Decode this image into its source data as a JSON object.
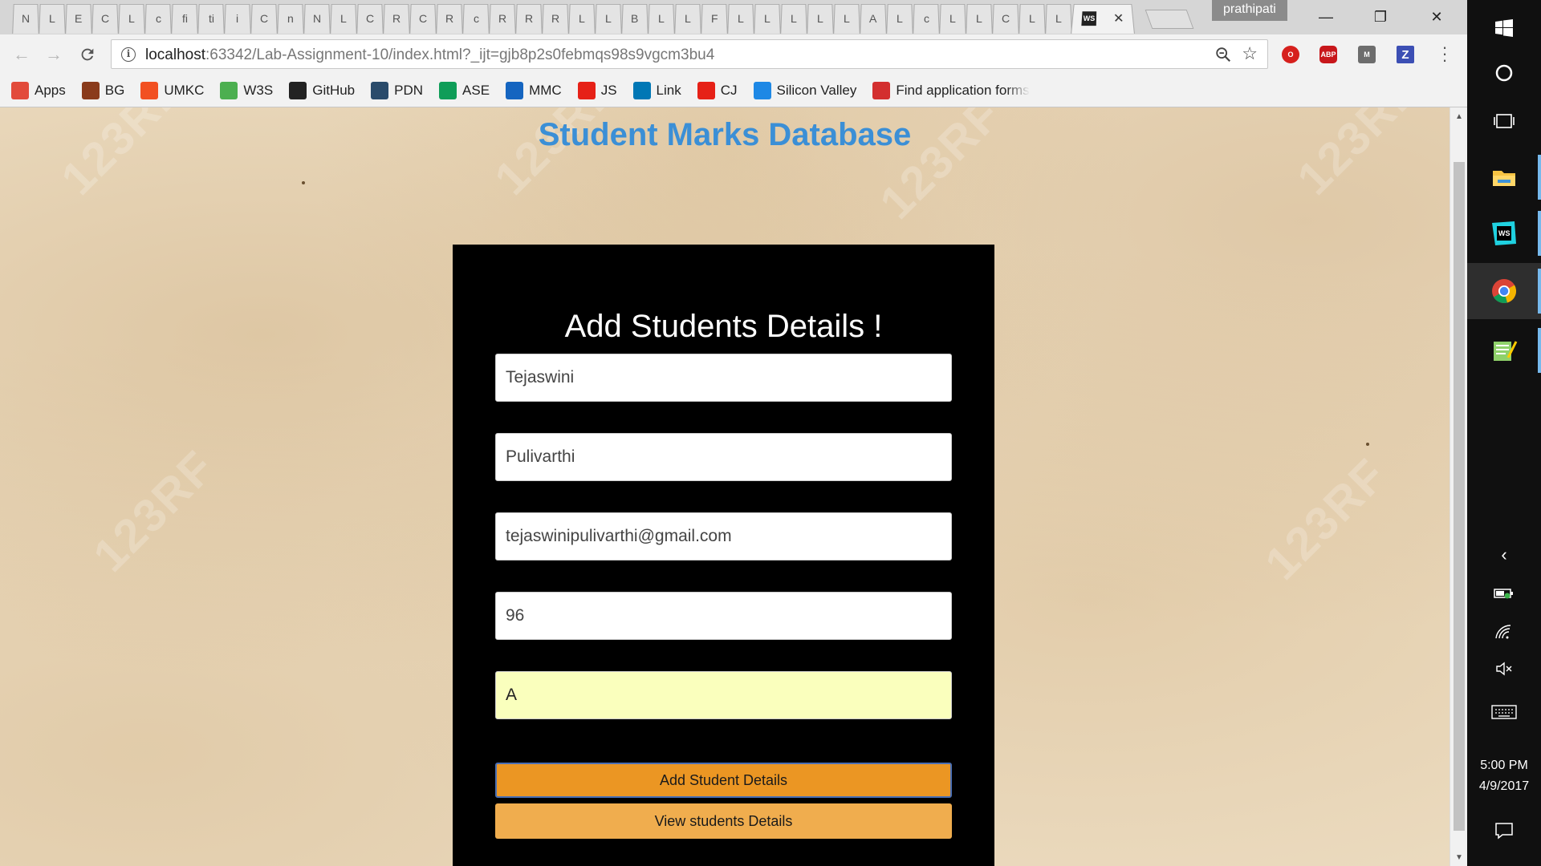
{
  "browser": {
    "tabs": [
      "N",
      "L",
      "E",
      "C",
      "L",
      "c",
      "fi",
      "ti",
      "i",
      "C",
      "n",
      "N",
      "L",
      "C",
      "R",
      "C",
      "R",
      "c",
      "R",
      "R",
      "R",
      "L",
      "L",
      "B",
      "L",
      "L",
      "F",
      "L",
      "L",
      "L",
      "L",
      "L",
      "A",
      "L",
      "c",
      "L",
      "L",
      "C",
      "L",
      "L"
    ],
    "active_tab_icon": "WS",
    "profile_name": "prathipati",
    "url_host": "localhost",
    "url_rest": ":63342/Lab-Assignment-10/index.html?_ijt=gjb8p2s0febmqs98s9vgcm3bu4"
  },
  "bookmarks": [
    {
      "label": "Apps",
      "icon": "apps-grid-icon",
      "color": "#e24b3b"
    },
    {
      "label": "BG",
      "icon": "bg-icon",
      "color": "#8a3b1c"
    },
    {
      "label": "UMKC",
      "icon": "windows-logo-icon",
      "color": "#f25022"
    },
    {
      "label": "W3S",
      "icon": "w3schools-icon",
      "color": "#4caf50"
    },
    {
      "label": "GitHub",
      "icon": "github-icon",
      "color": "#222222"
    },
    {
      "label": "PDN",
      "icon": "pdn-icon",
      "color": "#2a4b6b"
    },
    {
      "label": "ASE",
      "icon": "sheets-icon",
      "color": "#0f9d58"
    },
    {
      "label": "MMC",
      "icon": "mmc-icon",
      "color": "#1565c0"
    },
    {
      "label": "JS",
      "icon": "youtube-icon",
      "color": "#e62117"
    },
    {
      "label": "Link",
      "icon": "linkedin-icon",
      "color": "#0077b5"
    },
    {
      "label": "CJ",
      "icon": "youtube-icon",
      "color": "#e62117"
    },
    {
      "label": "Silicon Valley",
      "icon": "play-circle-icon",
      "color": "#1e88e5"
    },
    {
      "label": "Find application forms",
      "icon": "maple-leaf-icon",
      "color": "#d32f2f"
    }
  ],
  "page": {
    "title": "Student Marks Database",
    "watermark": "123RF"
  },
  "form": {
    "heading": "Add Students Details !",
    "first_name": "Tejaswini",
    "last_name": "Pulivarthi",
    "email": "tejaswinipulivarthi@gmail.com",
    "marks": "96",
    "grade": "A",
    "add_button": "Add Student Details",
    "view_button": "View students Details"
  },
  "taskbar": {
    "time": "5:00 PM",
    "date": "4/9/2017"
  },
  "colors": {
    "title_blue": "#3b8fd6",
    "button_orange": "#eb9623",
    "button_orange_light": "#f0ad4e",
    "autofill_yellow": "#faffbd"
  }
}
